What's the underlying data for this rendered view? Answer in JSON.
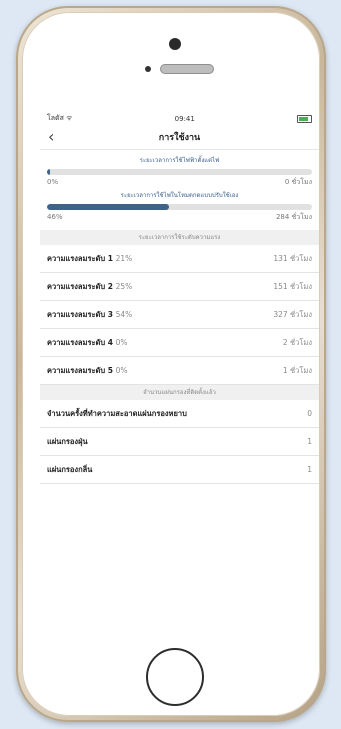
{
  "status_bar": {
    "carrier": "โลตัส ",
    "time": "09:41"
  },
  "nav": {
    "back_glyph": "‹",
    "title": "การใช้งาน"
  },
  "usage_since_start": {
    "label": "ระยะเวลาการใช้ไฟฟ้าตั้งแต่ไฟ",
    "percent_text": "0%",
    "value_text": "0 ชั่วโมง",
    "fill": 0.01
  },
  "manual_mode": {
    "label": "ระยะเวลาการใช้ไฟในโหมดกดแบบปรับใช้เอง",
    "percent_text": "46%",
    "value_text": "284 ชั่วโมง",
    "fill": 0.46
  },
  "intensity_section": {
    "header": "ระยะเวลาการใช้ระดับความแรง"
  },
  "levels": [
    {
      "label": "ความแรงลมระดับ 1",
      "pct": "21%",
      "value": "131 ชั่วโมง"
    },
    {
      "label": "ความแรงลมระดับ 2",
      "pct": "25%",
      "value": "151 ชั่วโมง"
    },
    {
      "label": "ความแรงลมระดับ 3",
      "pct": "54%",
      "value": "327 ชั่วโมง"
    },
    {
      "label": "ความแรงลมระดับ 4",
      "pct": "0%",
      "value": "2 ชั่วโมง"
    },
    {
      "label": "ความแรงลมระดับ 5",
      "pct": "0%",
      "value": "1 ชั่วโมง"
    }
  ],
  "filter_section": {
    "header": "จำนวนแผ่นกรองที่ติดตั้งแล้ว"
  },
  "filters": [
    {
      "label": "จำนวนครั้งที่ทำความสะอาดแผ่นกรองหยาบ",
      "value": "0"
    },
    {
      "label": "แผ่นกรองฝุ่น",
      "value": "1"
    },
    {
      "label": "แผ่นกรองกลิ่น",
      "value": "1"
    }
  ]
}
